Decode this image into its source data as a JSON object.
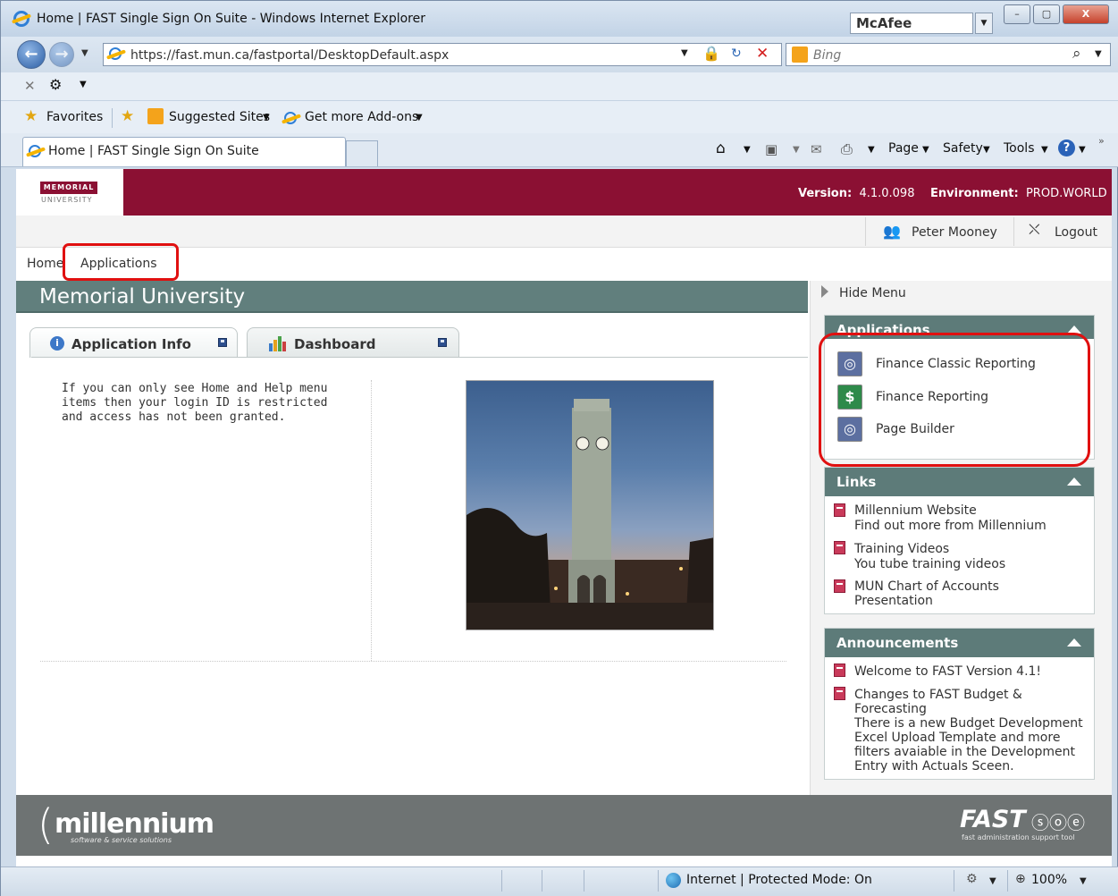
{
  "window": {
    "title": "Home | FAST Single Sign On Suite - Windows Internet Explorer",
    "mcafee": "McAfee",
    "minimize": "–",
    "maximize": "▢",
    "close": "X"
  },
  "address": {
    "url": "https://fast.mun.ca/fastportal/DesktopDefault.aspx",
    "search_placeholder": "Bing"
  },
  "favorites_bar": {
    "favorites": "Favorites",
    "suggested_sites": "Suggested Sites",
    "addons": "Get more Add-ons"
  },
  "tabs": {
    "active_tab": "Home | FAST Single Sign On Suite",
    "page": "Page",
    "safety": "Safety",
    "tools": "Tools"
  },
  "header": {
    "logo_text": "MEMORIAL",
    "logo_sub": "UNIVERSITY",
    "version_label": "Version:",
    "version_value": "4.1.0.098",
    "env_label": "Environment:",
    "env_value": "PROD.WORLD"
  },
  "user": {
    "name": "Peter Mooney",
    "logout": "Logout"
  },
  "breadcrumb": {
    "home": "Home",
    "applications": "Applications"
  },
  "main": {
    "title": "Memorial University",
    "tab_info": "Application Info",
    "tab_dashboard": "Dashboard",
    "info_text": "If you can only see Home and Help menu items then your login ID is restricted and access has not been granted."
  },
  "sidebar": {
    "hide_menu": "Hide Menu",
    "applications_title": "Applications",
    "apps": [
      {
        "label": "Finance Classic Reporting"
      },
      {
        "label": "Finance Reporting"
      },
      {
        "label": "Page Builder"
      }
    ],
    "links_title": "Links",
    "links": [
      {
        "title": "Millennium Website",
        "desc": "Find out more from Millennium"
      },
      {
        "title": "Training Videos",
        "desc": "You tube training videos"
      },
      {
        "title": "MUN Chart of Accounts",
        "desc": "Presentation"
      }
    ],
    "announcements_title": "Announcements",
    "announcements": [
      {
        "title": "Welcome to FAST Version 4.1!",
        "desc": ""
      },
      {
        "title": "Changes to FAST Budget & Forecasting",
        "desc": "There is a new Budget Development Excel Upload Template and more filters avaiable in the Development Entry with Actuals Sceen."
      }
    ]
  },
  "footer": {
    "millennium": "millennium",
    "millennium_tag": "software & service solutions",
    "fast": "FAST",
    "fast_tag": "fast administration support tool"
  },
  "status": {
    "zone": "Internet | Protected Mode: On",
    "zoom": "100%"
  },
  "colors": {
    "brand": "#8b1033",
    "panel": "#5d7b79",
    "highlight": "#e01010"
  }
}
